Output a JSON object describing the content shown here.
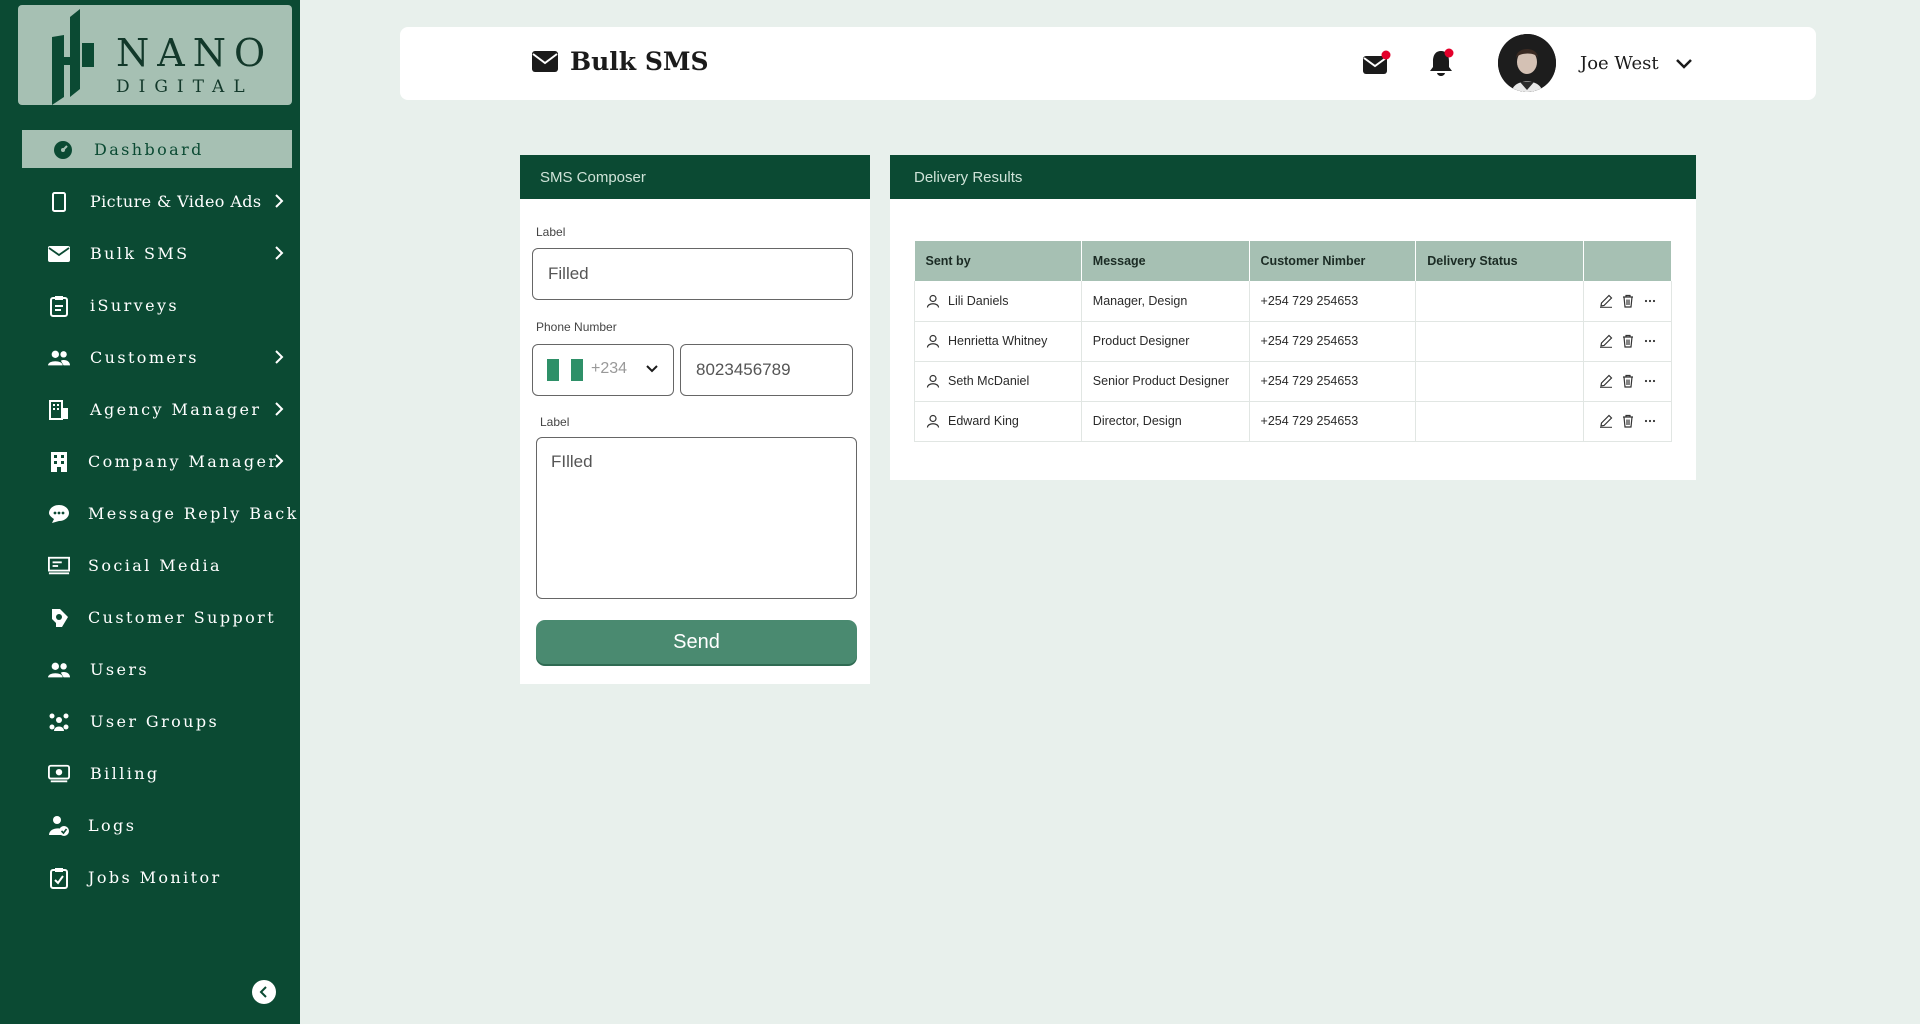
{
  "brand": {
    "line1": "NANO",
    "line2": "DIGITAL"
  },
  "sidebar": {
    "items": [
      {
        "label": "Dashboard",
        "icon": "dashboard-icon",
        "active": true,
        "chevron": false
      },
      {
        "label": "Picture & Video Ads",
        "icon": "tablet-icon",
        "chevron": true
      },
      {
        "label": "Bulk SMS",
        "icon": "mail-icon",
        "chevron": true
      },
      {
        "label": "iSurveys",
        "icon": "clipboard-icon",
        "chevron": false
      },
      {
        "label": "Customers",
        "icon": "customers-icon",
        "chevron": true
      },
      {
        "label": "Agency Manager",
        "icon": "agency-icon",
        "chevron": true
      },
      {
        "label": "Company Manager",
        "icon": "building-icon",
        "chevron": true
      },
      {
        "label": "Message Reply Back",
        "icon": "chat-icon",
        "chevron": false
      },
      {
        "label": "Social Media",
        "icon": "monitor-icon",
        "chevron": false
      },
      {
        "label": "Customer Support",
        "icon": "support-icon",
        "chevron": false
      },
      {
        "label": "Users",
        "icon": "users-icon",
        "chevron": false
      },
      {
        "label": "User Groups",
        "icon": "user-groups-icon",
        "chevron": false
      },
      {
        "label": "Billing",
        "icon": "billing-icon",
        "chevron": false
      },
      {
        "label": "Logs",
        "icon": "logs-icon",
        "chevron": false
      },
      {
        "label": "Jobs Monitor",
        "icon": "jobs-icon",
        "chevron": false
      }
    ]
  },
  "header": {
    "title": "Bulk SMS",
    "user_name": "Joe West"
  },
  "composer": {
    "title": "SMS Composer",
    "label1": "Label",
    "value1": "Filled",
    "phone_label": "Phone Number",
    "dial_code": "+234",
    "phone_value": "8023456789",
    "label2": "Label",
    "message_value": "FIlled",
    "send_label": "Send"
  },
  "results": {
    "title": "Delivery Results",
    "columns": [
      "Sent by",
      "Message",
      "Customer Nimber",
      "Delivery Status",
      ""
    ],
    "rows": [
      {
        "sent_by": "Lili Daniels",
        "message": "Manager, Design",
        "number": "+254 729 254653",
        "status": ""
      },
      {
        "sent_by": "Henrietta Whitney",
        "message": "Product Designer",
        "number": "+254 729 254653",
        "status": ""
      },
      {
        "sent_by": "Seth McDaniel",
        "message": "Senior Product Designer",
        "number": "+254 729 254653",
        "status": ""
      },
      {
        "sent_by": "Edward King",
        "message": "Director, Design",
        "number": "+254 729 254653",
        "status": ""
      }
    ]
  },
  "colors": {
    "sidebar": "#0b4a33",
    "sidebar_highlight": "#a6c0b3",
    "background": "#e8f0ec",
    "send_button": "#4a8a70",
    "notification_dot": "#e4002b"
  }
}
